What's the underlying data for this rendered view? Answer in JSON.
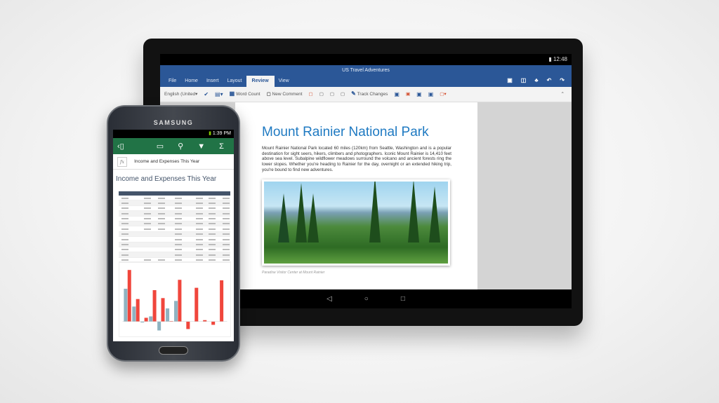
{
  "tablet": {
    "status_time": "12:48",
    "doc_title": "US Travel Adventures",
    "tabs": [
      "File",
      "Home",
      "Insert",
      "Layout",
      "Review",
      "View"
    ],
    "active_tab": "Review",
    "ribbon": {
      "language": "English (United▾",
      "word_count": "Word Count",
      "new_comment": "New Comment",
      "track_changes": "Track Changes"
    },
    "heading": "Mount Rainier National Park",
    "body": "Mount Rainier National Park located 60 miles (120km) from Seattle, Washington and is a popular destination for sight seers, hikers, climbers and photographers. Iconic Mount Rainier is 14,410 feet above sea level. Subalpine wildflower meadows surround the volcano and ancient forests ring the lower slopes. Whether you're heading to Rainier for the day, overnight or an extended hiking trip, you're bound to find new adventures.",
    "caption": "Paradise Visitor Center at Mount Rainier"
  },
  "phone": {
    "brand": "SAMSUNG",
    "status_time": "1:39 PM",
    "formula_label": "fx",
    "formula_value": "Income and Expenses This Year",
    "sheet_title": "Income and Expenses This Year",
    "accent": "#217346"
  },
  "chart_data": {
    "type": "bar",
    "series": [
      {
        "color": "#8fb3c1",
        "values": [
          7,
          3.2,
          -0.2,
          1.1,
          -1.9,
          2.8,
          4.4,
          null,
          null,
          null,
          null,
          null
        ]
      },
      {
        "color": "#f0463c",
        "values": [
          11,
          4.8,
          0.8,
          6.7,
          5,
          0.1,
          8.9,
          -1.6,
          7.2,
          0.3,
          -0.7,
          8.8
        ]
      }
    ],
    "ylim": [
      -2,
      11.5
    ]
  }
}
